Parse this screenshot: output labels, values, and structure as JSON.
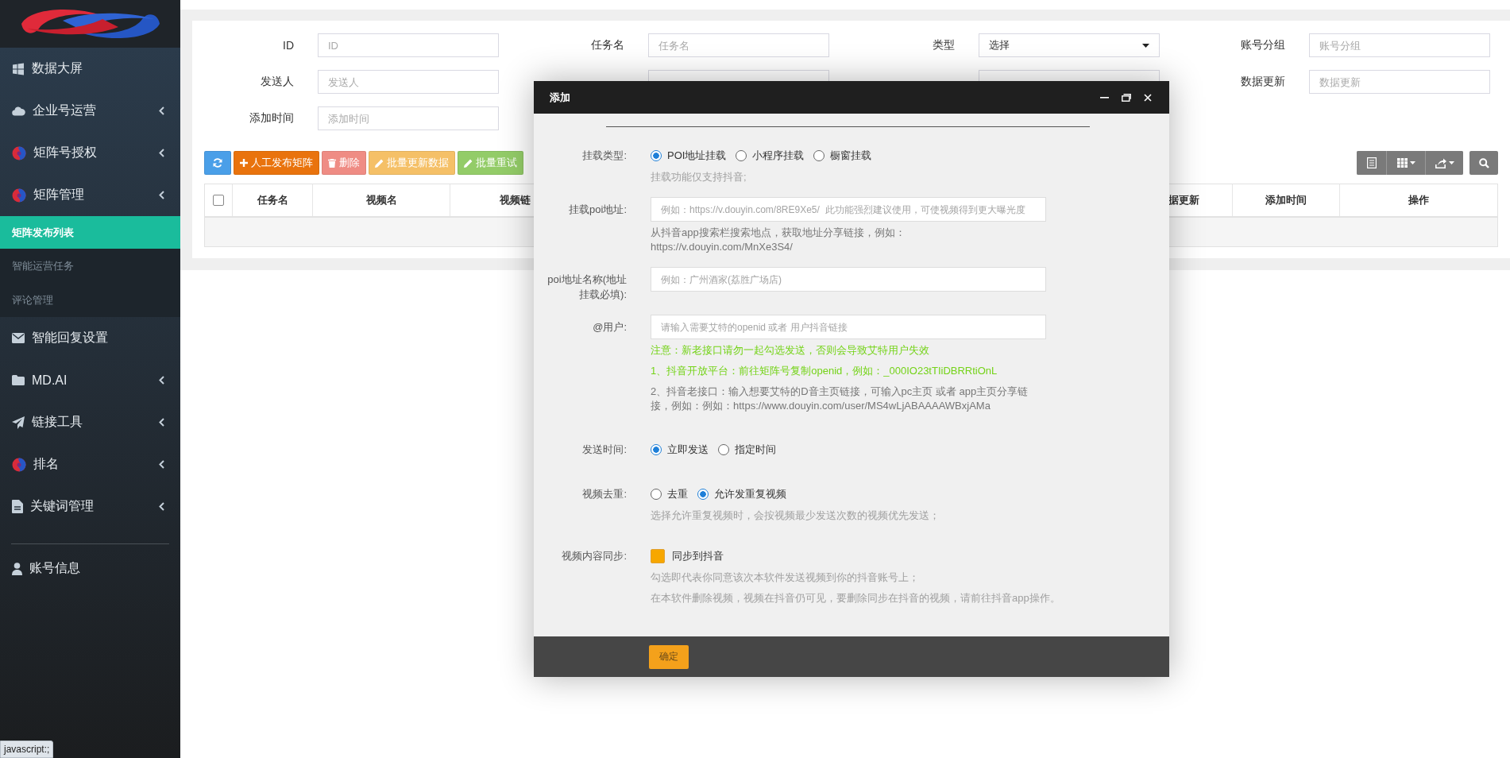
{
  "sidebar": {
    "items": [
      {
        "label": "数据大屏",
        "has_submenu": false
      },
      {
        "label": "企业号运营",
        "has_submenu": true
      },
      {
        "label": "矩阵号授权",
        "has_submenu": true
      },
      {
        "label": "矩阵管理",
        "has_submenu": true,
        "children": [
          {
            "label": "矩阵发布列表",
            "selected": true
          },
          {
            "label": "智能运营任务",
            "selected": false
          },
          {
            "label": "评论管理",
            "selected": false
          }
        ]
      },
      {
        "label": "智能回复设置",
        "has_submenu": false
      },
      {
        "label": "MD.AI",
        "has_submenu": true
      },
      {
        "label": "链接工具",
        "has_submenu": true
      },
      {
        "label": "排名",
        "has_submenu": true
      },
      {
        "label": "关键词管理",
        "has_submenu": true
      }
    ],
    "footer_items": [
      {
        "label": "账号信息"
      }
    ]
  },
  "filters": {
    "rows": [
      [
        {
          "kind": "text",
          "label": "ID",
          "placeholder": "ID"
        },
        {
          "kind": "text",
          "label": "任务名",
          "placeholder": "任务名"
        },
        {
          "kind": "select",
          "label": "类型",
          "value": "选择"
        },
        {
          "kind": "text",
          "label": "账号分组",
          "placeholder": "账号分组"
        }
      ],
      [
        {
          "kind": "text",
          "label": "发送人",
          "placeholder": "发送人"
        },
        {
          "kind": "covered"
        },
        {
          "kind": "covered"
        },
        {
          "kind": "text",
          "label": "数据更新",
          "placeholder": "数据更新"
        }
      ],
      [
        {
          "kind": "text",
          "label": "添加时间",
          "placeholder": "添加时间"
        }
      ]
    ]
  },
  "toolbar": {
    "buttons": [
      {
        "kind": "refresh",
        "color": "#4a9fe8"
      },
      {
        "kind": "add",
        "label": "人工发布矩阵",
        "color": "#e9730d"
      },
      {
        "kind": "delete",
        "label": "删除",
        "color": "#ef8c84"
      },
      {
        "kind": "edit",
        "label": "批量更新数据",
        "color": "#f5c067"
      },
      {
        "kind": "edit",
        "label": "批量重试",
        "color": "#93cc68"
      }
    ]
  },
  "table": {
    "columns": [
      {
        "kind": "checkbox",
        "checked": false
      },
      {
        "kind": "text",
        "label": "任务名"
      },
      {
        "kind": "text",
        "label": "视频名"
      },
      {
        "kind": "cut_start",
        "label": "视频链"
      },
      {
        "kind": "covered"
      },
      {
        "kind": "cut_end",
        "label": "据更新"
      },
      {
        "kind": "text",
        "label": "添加时间"
      },
      {
        "kind": "text",
        "label": "操作"
      }
    ]
  },
  "dialog": {
    "title": "添加",
    "rows": [
      {
        "kind": "radio",
        "label": "挂载类型:",
        "options": [
          {
            "label": "POI地址挂载",
            "selected": true
          },
          {
            "label": "小程序挂载",
            "selected": false
          },
          {
            "label": "橱窗挂载",
            "selected": false
          }
        ],
        "notes": [
          {
            "color": "#a0a0a0",
            "text": "挂载功能仅支持抖音;"
          }
        ]
      },
      {
        "kind": "input",
        "label": "挂载poi地址:",
        "placeholder": "例如：https://v.douyin.com/8RE9Xe5/  此功能强烈建议使用，可使视频得到更大曝光度",
        "notes": [
          {
            "color": "#777777",
            "text": "从抖音app搜索栏搜索地点，获取地址分享链接，例如：https://v.douyin.com/MnXe3S4/"
          }
        ]
      },
      {
        "kind": "input",
        "label": "poi地址名称(地址挂载必填):",
        "placeholder": "例如：广州酒家(荔胜广场店)"
      },
      {
        "kind": "input",
        "label": "@用户:",
        "placeholder": "请输入需要艾特的openid 或者 用户抖音链接",
        "notes": [
          {
            "color": "#74d318",
            "text": "注意：新老接口请勿一起勾选发送，否则会导致艾特用户失效"
          },
          {
            "color": "#74d318",
            "text": "1、抖音开放平台：前往矩阵号复制openid，例如：_000IO23tTIiDBRRtiOnL"
          },
          {
            "color": "#777777",
            "text": "2、抖音老接口：输入想要艾特的D音主页链接，可输入pc主页 或者 app主页分享链接，例如：例如：https://www.douyin.com/user/MS4wLjABAAAAWBxjAMa"
          }
        ]
      },
      {
        "kind": "radio",
        "label": "发送时间:",
        "options": [
          {
            "label": "立即发送",
            "selected": true
          },
          {
            "label": "指定时间",
            "selected": false
          }
        ]
      },
      {
        "kind": "radio",
        "label": "视频去重:",
        "options": [
          {
            "label": "去重",
            "selected": false
          },
          {
            "label": "允许发重复视频",
            "selected": true
          }
        ],
        "notes": [
          {
            "color": "#a0a0a0",
            "text": "选择允许重复视频时，会按视频最少发送次数的视频优先发送；"
          }
        ]
      },
      {
        "kind": "checkbox",
        "label": "视频内容同步:",
        "option": {
          "label": "同步到抖音",
          "checked": true
        },
        "notes": [
          {
            "color": "#a0a0a0",
            "text": "勾选即代表你同意该次本软件发送视频到你的抖音账号上；"
          },
          {
            "color": "#a0a0a0",
            "text": "在本软件删除视频，视频在抖音仍可见，要删除同步在抖音的视频，请前往抖音app操作。"
          }
        ]
      }
    ],
    "buttons": [
      "确定"
    ]
  },
  "status_tooltip": "javascript:;"
}
